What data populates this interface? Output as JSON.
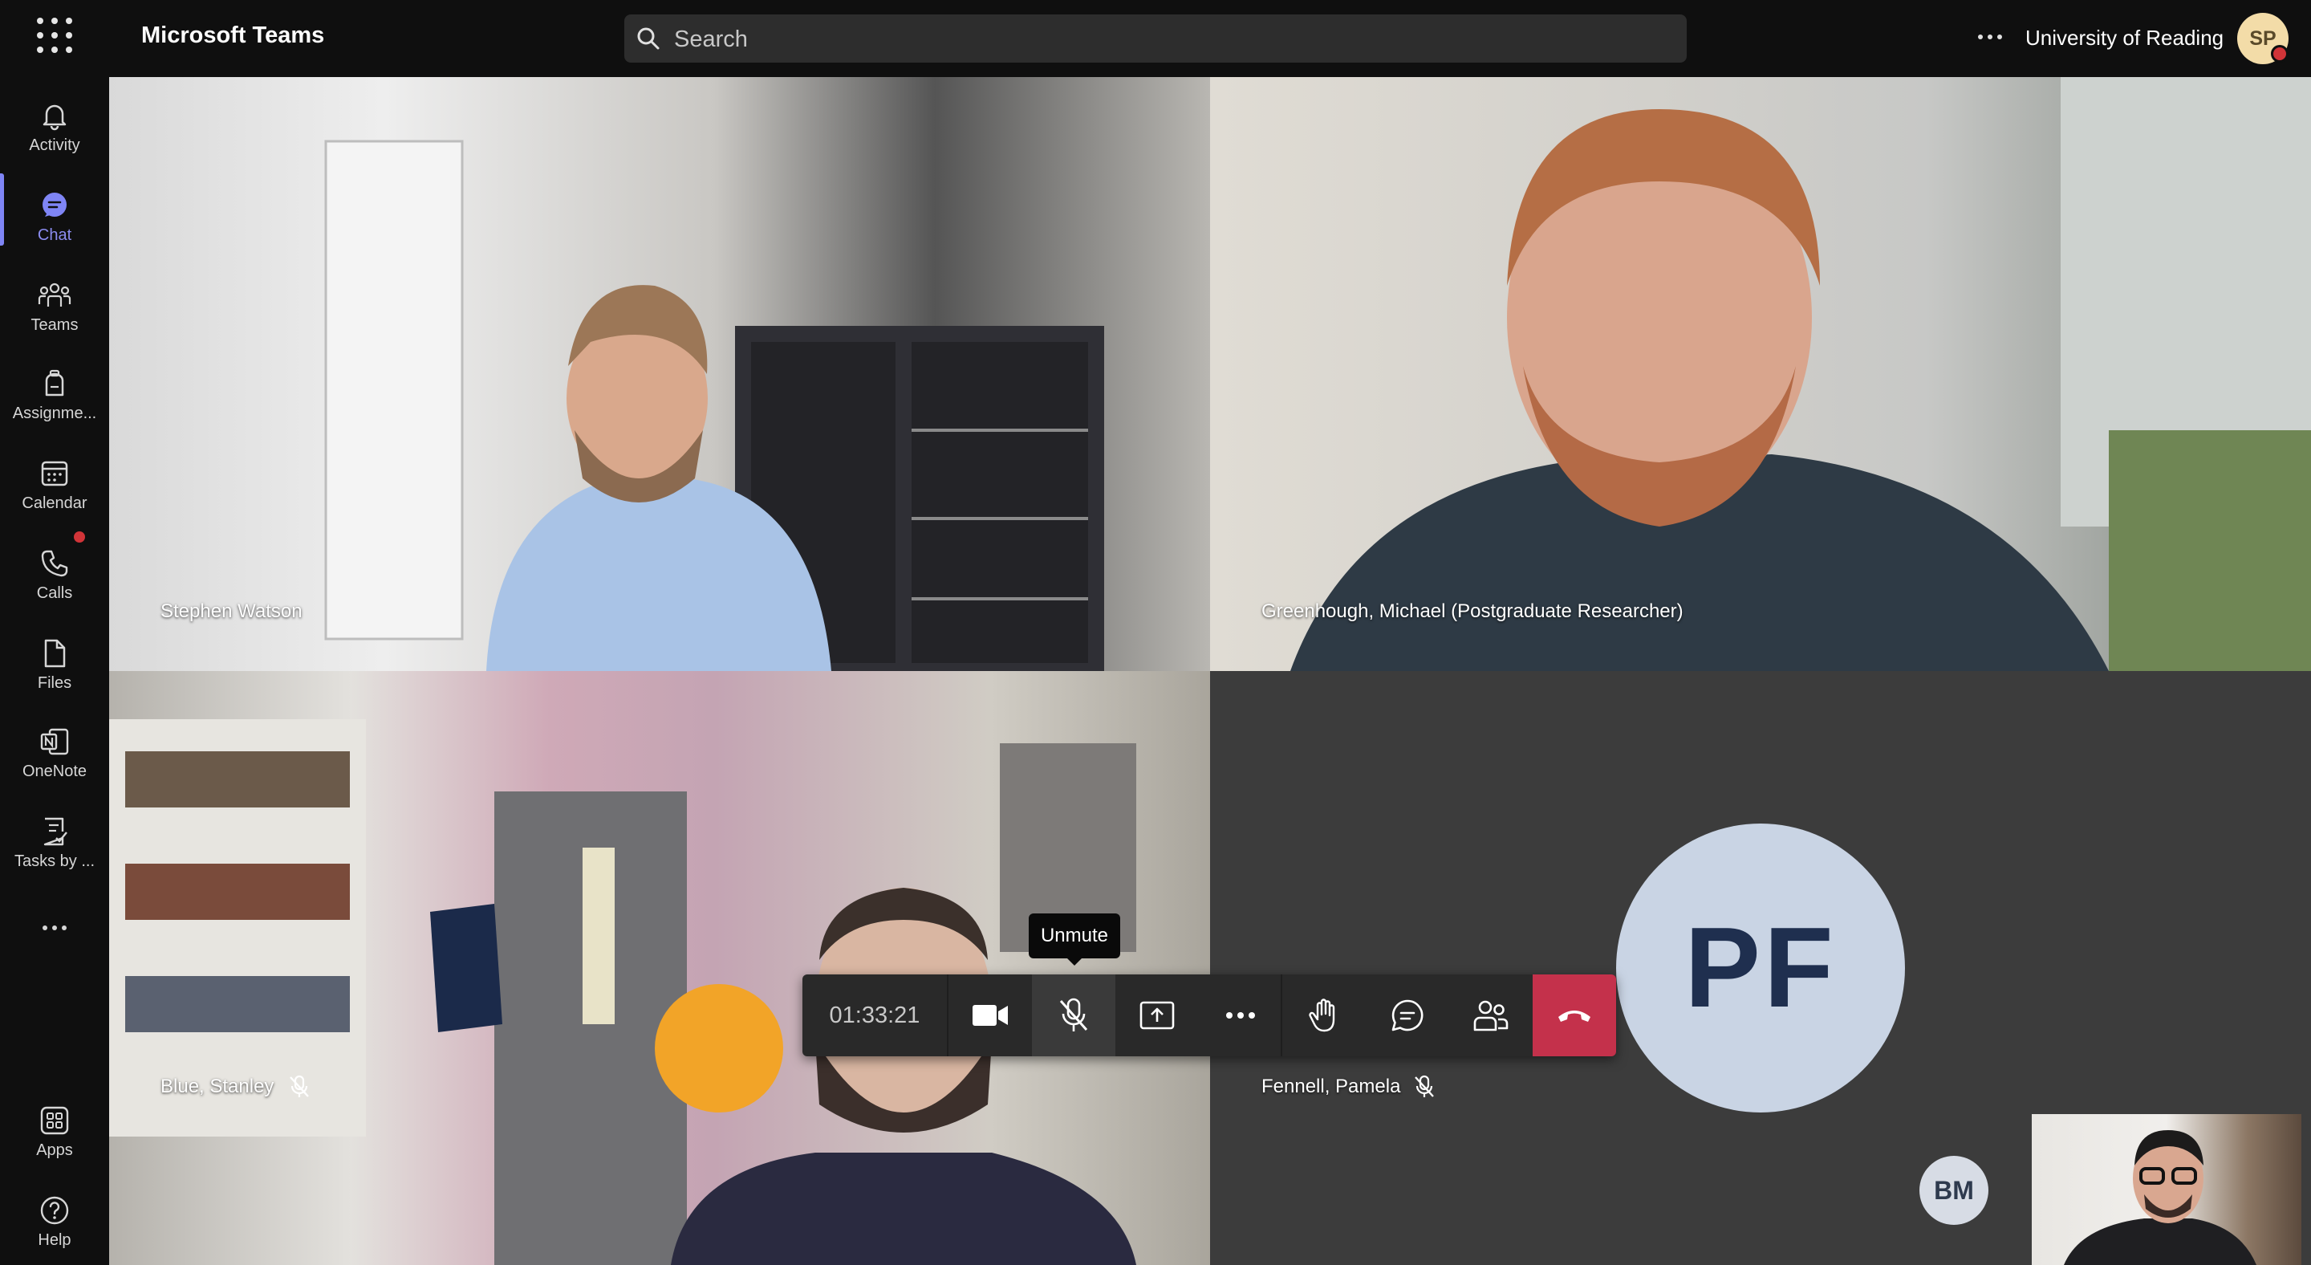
{
  "app": {
    "title": "Microsoft Teams"
  },
  "search": {
    "placeholder": "Search"
  },
  "org": {
    "name": "University of Reading"
  },
  "user": {
    "initials": "SP"
  },
  "rail": {
    "items": [
      {
        "label": "Activity"
      },
      {
        "label": "Chat"
      },
      {
        "label": "Teams"
      },
      {
        "label": "Assignme..."
      },
      {
        "label": "Calendar"
      },
      {
        "label": "Calls"
      },
      {
        "label": "Files"
      },
      {
        "label": "OneNote"
      },
      {
        "label": "Tasks by ..."
      },
      {
        "label": "Apps"
      },
      {
        "label": "Help"
      }
    ]
  },
  "participants": [
    {
      "name": "Stephen Watson"
    },
    {
      "name": "Greenhough, Michael (Postgraduate Researcher)"
    },
    {
      "name": "Blue, Stanley"
    },
    {
      "name": "Fennell, Pamela",
      "initials": "PF"
    }
  ],
  "extra_participant": {
    "initials": "BM"
  },
  "call": {
    "timer": "01:33:21",
    "tooltip": "Unmute"
  },
  "colors": {
    "accent": "#7f85f5",
    "hangup": "#c4314b",
    "presence_busy": "#d13438"
  }
}
